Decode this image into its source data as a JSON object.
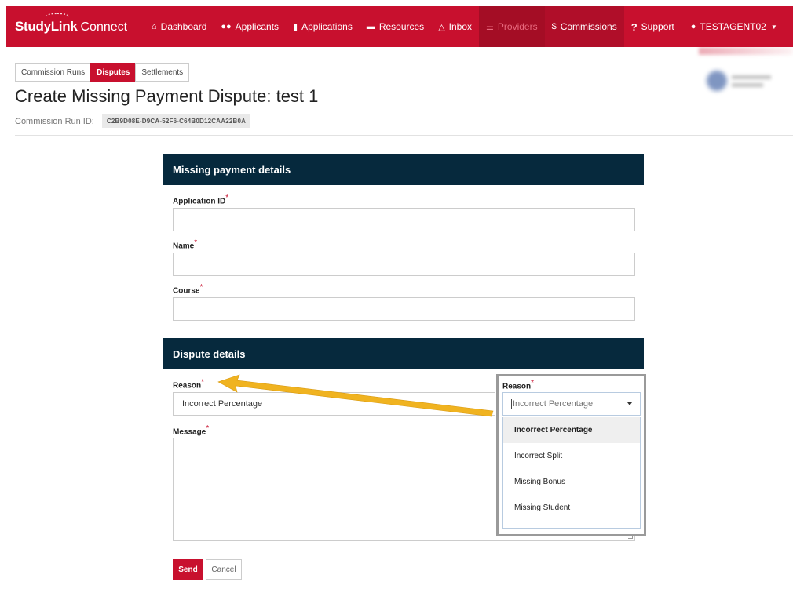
{
  "brand": {
    "name_bold": "StudyLink",
    "name_light": "Connect"
  },
  "nav": {
    "items": [
      {
        "label": "Dashboard",
        "icon": "home-icon"
      },
      {
        "label": "Applicants",
        "icon": "users-icon"
      },
      {
        "label": "Applications",
        "icon": "file-icon"
      },
      {
        "label": "Resources",
        "icon": "folder-icon"
      },
      {
        "label": "Inbox",
        "icon": "inbox-icon"
      },
      {
        "label": "Providers",
        "icon": "bank-icon"
      },
      {
        "label": "Commissions",
        "icon": "dollar-icon"
      },
      {
        "label": "Support",
        "icon": "question-icon"
      },
      {
        "label": "TESTAGENT02",
        "icon": "user-icon"
      }
    ]
  },
  "subtabs": {
    "runs": "Commission Runs",
    "disputes": "Disputes",
    "settlements": "Settlements"
  },
  "page": {
    "title": "Create Missing Payment Dispute: test 1",
    "run_id_label": "Commission Run ID:",
    "run_id_value": "C2B9D08E-D9CA-52F6-C64B0D12CAA22B0A"
  },
  "missing_payment": {
    "heading": "Missing payment details",
    "application_id_label": "Application ID",
    "name_label": "Name",
    "course_label": "Course",
    "required_mark": "*"
  },
  "dispute": {
    "heading": "Dispute details",
    "reason_label": "Reason",
    "reason_value": "Incorrect Percentage",
    "message_label": "Message"
  },
  "buttons": {
    "send": "Send",
    "cancel": "Cancel"
  },
  "popup": {
    "label": "Reason",
    "placeholder": "Incorrect Percentage",
    "options": [
      "Incorrect Percentage",
      "Incorrect Split",
      "Missing Bonus",
      "Missing Student"
    ],
    "selected_index": 0
  },
  "colors": {
    "brand_red": "#c8102e",
    "panel_navy": "#06293d",
    "arrow": "#f0b320"
  }
}
